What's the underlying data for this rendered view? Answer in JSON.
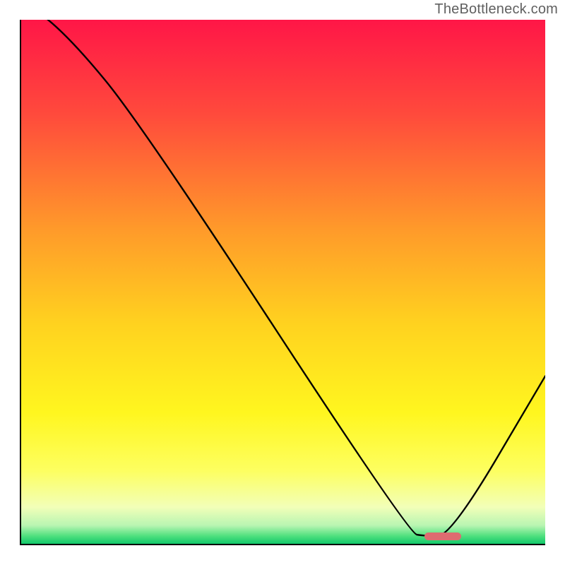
{
  "attribution": "TheBottleneck.com",
  "colors": {
    "curve": "#000000",
    "marker": "#de6b70",
    "gradient_top": "#ff1647",
    "gradient_bottom": "#12c96b"
  },
  "chart_data": {
    "type": "line",
    "title": "",
    "xlabel": "",
    "ylabel": "",
    "xlim": [
      0,
      100
    ],
    "ylim": [
      0,
      100
    ],
    "series": [
      {
        "name": "bottleneck_curve",
        "x": [
          0,
          9,
          23,
          74,
          77,
          82,
          100
        ],
        "values": [
          104,
          97,
          80,
          2,
          1.5,
          1.5,
          32
        ]
      }
    ],
    "marker": {
      "x_start": 77,
      "x_end": 84,
      "y": 1.5
    },
    "notes": "y=0 is bottom (green, no bottleneck); y=100 is top (red, full bottleneck). Values above 100 indicate the curve exits the top of the plot."
  }
}
